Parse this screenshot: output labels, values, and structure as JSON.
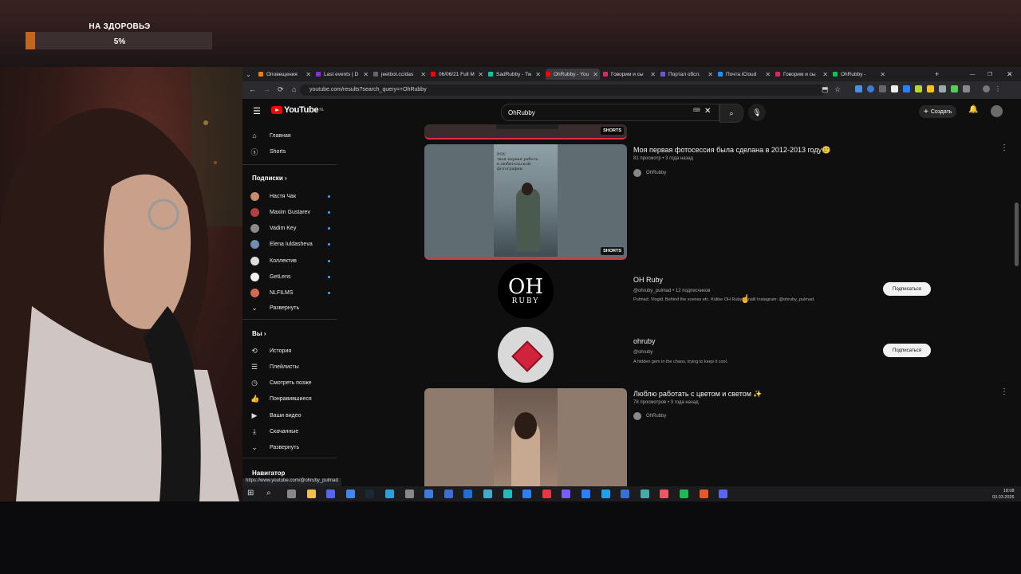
{
  "overlay": {
    "goal_title": "НА ЗДОРОВЬЭ",
    "goal_percent": "5%",
    "goal_fraction": 0.05,
    "accent": "#c0661e"
  },
  "browser": {
    "tabs": [
      {
        "label": "Оповещения",
        "color": "#ff7a00"
      },
      {
        "label": "Last events | D",
        "color": "#8a2be2"
      },
      {
        "label": "jeetbot.cc/das",
        "color": "#666"
      },
      {
        "label": "06/06/21 Full M",
        "color": "#ff0000"
      },
      {
        "label": "SadRubby - Tw",
        "color": "#00c8a0"
      },
      {
        "label": "OhRubby - You",
        "color": "#ff0000"
      },
      {
        "label": "Говорим и сы",
        "color": "#e0245e"
      },
      {
        "label": "Портал обсл.",
        "color": "#6a5acd"
      },
      {
        "label": "Почта iCloud",
        "color": "#1e90ff"
      },
      {
        "label": "Говорим и сы",
        "color": "#e0245e"
      },
      {
        "label": "OhRubby -",
        "color": "#00c853"
      }
    ],
    "url": "youtube.com/results?search_query=+OhRubby",
    "status_url": "https://www.youtube.com/@ohruby_pulmad"
  },
  "youtube": {
    "logo_text": "YouTube",
    "logo_country": "NL",
    "search_value": "OhRubby",
    "create_label": "Создать",
    "sidebar": {
      "home": "Главная",
      "shorts": "Shorts",
      "subs_heading": "Подписки",
      "subs": [
        {
          "name": "Настя Чак",
          "avatar": "#c98b6b"
        },
        {
          "name": "Maxim Gustarev",
          "avatar": "#b0413e"
        },
        {
          "name": "Vadim Key",
          "avatar": "#8a8a8a"
        },
        {
          "name": "Elena Iuldasheva",
          "avatar": "#6e8fb3"
        },
        {
          "name": "Коллектив",
          "avatar": "#dddddd"
        },
        {
          "name": "GetLens",
          "avatar": "#f0f0f0"
        },
        {
          "name": "NLFILMS",
          "avatar": "#d36a4f"
        }
      ],
      "expand1": "Развернуть",
      "you_heading": "Вы",
      "you_items": [
        "История",
        "Плейлисты",
        "Смотреть позже",
        "Понравившиеся",
        "Ваши видео",
        "Скачанные",
        "Развернуть"
      ],
      "navigator": "Навигатор"
    },
    "results": {
      "shorts_badge": "SHORTS",
      "video1": {
        "title": "Моя первая фотосессия была сделана в 2012-2013 году🥲",
        "meta": "81 просмотр • 3 года назад",
        "channel": "OhRubby",
        "thumb_text": "POV\nтвоя первая работа\nв любительской фотографии"
      },
      "channel1": {
        "name": "OH Ruby",
        "logo_top": "OH",
        "logo_bottom": "RUBY",
        "meta": "@ohruby_pulmad • 12 подписчиков",
        "desc": "Pulmad. Vlogid. Behind the scenes etc. Külike OH Ruby kanalil Instagram: @ohruby_pulmad.",
        "subscribe": "Подписаться"
      },
      "channel2": {
        "name": "ohruby",
        "meta": "@ohruby",
        "desc": "A hidden gem in the chaos, trying to keep it cool.",
        "subscribe": "Подписаться"
      },
      "video2": {
        "title": "Люблю работать с цветом и светом ✨",
        "meta": "78 просмотров • 3 года назад",
        "channel": "OhRubby"
      }
    }
  },
  "taskbar": {
    "time": "18:08",
    "date": "03.03.2026"
  }
}
